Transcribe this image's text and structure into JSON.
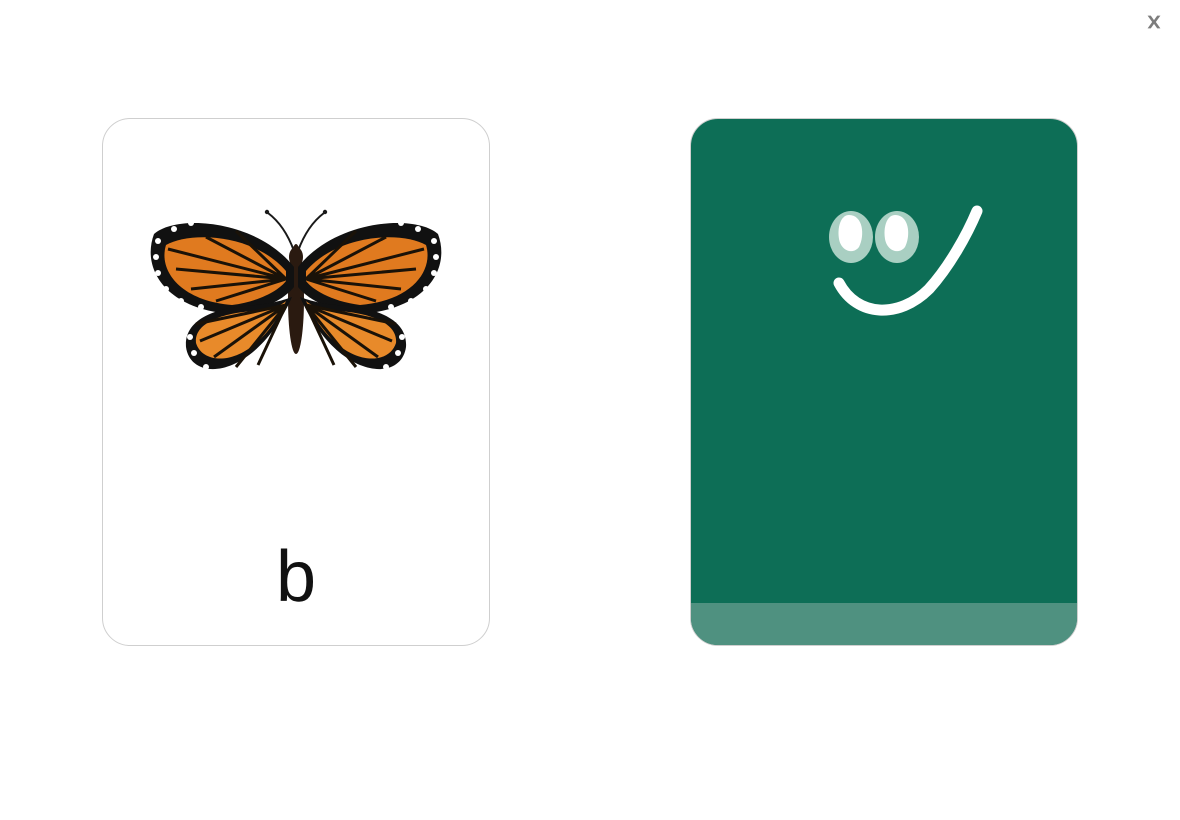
{
  "close_icon": "close",
  "cards": {
    "left": {
      "image": "butterfly",
      "letter": "b",
      "bg": "#ffffff",
      "border": "#cfcfcf"
    },
    "right": {
      "bg": "#0d6e56",
      "footer_bg": "#4f9180",
      "face_icon": "smiley-face"
    }
  }
}
